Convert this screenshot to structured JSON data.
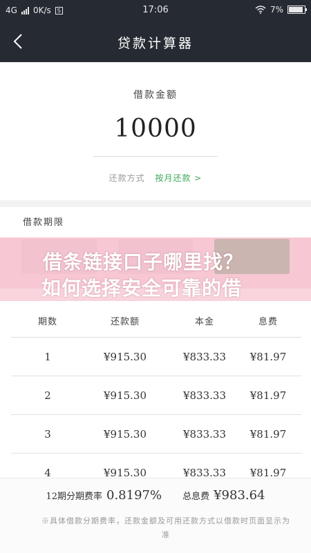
{
  "status_bar": {
    "network": "4G",
    "speed": "0K/s",
    "time": "17:06",
    "battery_percent": "7%"
  },
  "nav": {
    "title": "贷款计算器",
    "back_icon": "chevron-left-icon"
  },
  "loan": {
    "amount_label": "借款金额",
    "amount_value": "10000",
    "repay_label": "还款方式",
    "repay_method": "按月还款 >"
  },
  "term": {
    "label": "借款期限",
    "selected_index": 2
  },
  "overlay": {
    "line1": "借条链接口子哪里找？",
    "line2": "如何选择安全可靠的借"
  },
  "table": {
    "headers": [
      "期数",
      "还款额",
      "本金",
      "息费"
    ],
    "rows": [
      [
        "1",
        "¥915.30",
        "¥833.33",
        "¥81.97"
      ],
      [
        "2",
        "¥915.30",
        "¥833.33",
        "¥81.97"
      ],
      [
        "3",
        "¥915.30",
        "¥833.33",
        "¥81.97"
      ],
      [
        "4",
        "¥915.30",
        "¥833.33",
        "¥81.97"
      ]
    ]
  },
  "summary": {
    "rate_label": "12期分期费率",
    "rate_value": "0.8197%",
    "total_label": "总息费",
    "total_value": "¥983.64",
    "note": "※具体借款分期费率，还款金额及可用还款方式以借款时页面显示为准"
  },
  "colors": {
    "nav_bg": "#262b33",
    "accent_green": "#3aa85a",
    "overlay_pink": "#f5b9c8"
  }
}
